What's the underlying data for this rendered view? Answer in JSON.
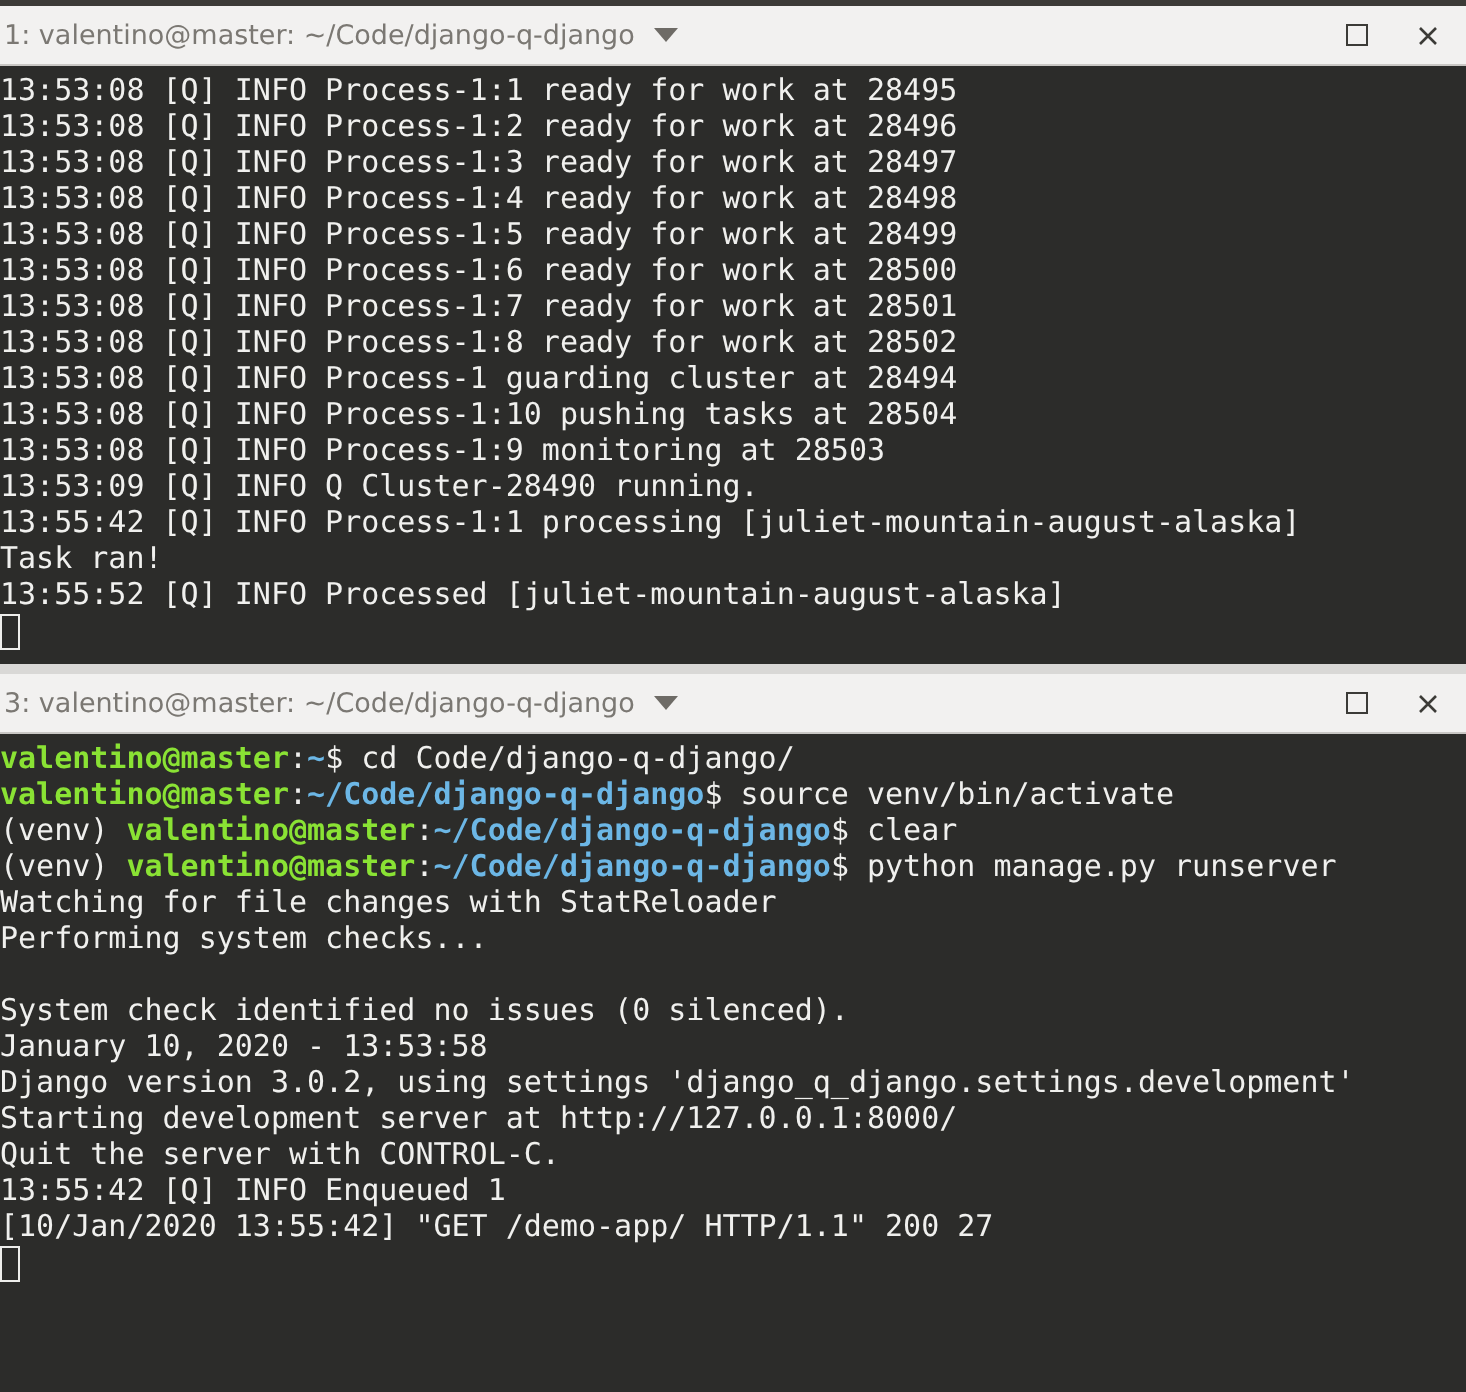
{
  "panes": [
    {
      "title": "1: valentino@master: ~/Code/django-q-django",
      "lines": [
        {
          "segments": [
            {
              "kind": "plain",
              "text": "13:53:08 [Q] INFO Process-1:1 ready for work at 28495"
            }
          ]
        },
        {
          "segments": [
            {
              "kind": "plain",
              "text": "13:53:08 [Q] INFO Process-1:2 ready for work at 28496"
            }
          ]
        },
        {
          "segments": [
            {
              "kind": "plain",
              "text": "13:53:08 [Q] INFO Process-1:3 ready for work at 28497"
            }
          ]
        },
        {
          "segments": [
            {
              "kind": "plain",
              "text": "13:53:08 [Q] INFO Process-1:4 ready for work at 28498"
            }
          ]
        },
        {
          "segments": [
            {
              "kind": "plain",
              "text": "13:53:08 [Q] INFO Process-1:5 ready for work at 28499"
            }
          ]
        },
        {
          "segments": [
            {
              "kind": "plain",
              "text": "13:53:08 [Q] INFO Process-1:6 ready for work at 28500"
            }
          ]
        },
        {
          "segments": [
            {
              "kind": "plain",
              "text": "13:53:08 [Q] INFO Process-1:7 ready for work at 28501"
            }
          ]
        },
        {
          "segments": [
            {
              "kind": "plain",
              "text": "13:53:08 [Q] INFO Process-1:8 ready for work at 28502"
            }
          ]
        },
        {
          "segments": [
            {
              "kind": "plain",
              "text": "13:53:08 [Q] INFO Process-1 guarding cluster at 28494"
            }
          ]
        },
        {
          "segments": [
            {
              "kind": "plain",
              "text": "13:53:08 [Q] INFO Process-1:10 pushing tasks at 28504"
            }
          ]
        },
        {
          "segments": [
            {
              "kind": "plain",
              "text": "13:53:08 [Q] INFO Process-1:9 monitoring at 28503"
            }
          ]
        },
        {
          "segments": [
            {
              "kind": "plain",
              "text": "13:53:09 [Q] INFO Q Cluster-28490 running."
            }
          ]
        },
        {
          "segments": [
            {
              "kind": "plain",
              "text": "13:55:42 [Q] INFO Process-1:1 processing [juliet-mountain-august-alaska]"
            }
          ]
        },
        {
          "segments": [
            {
              "kind": "plain",
              "text": "Task ran!"
            }
          ]
        },
        {
          "segments": [
            {
              "kind": "plain",
              "text": "13:55:52 [Q] INFO Processed [juliet-mountain-august-alaska]"
            }
          ]
        }
      ]
    },
    {
      "title": "3: valentino@master: ~/Code/django-q-django",
      "lines": [
        {
          "segments": [
            {
              "kind": "user",
              "text": "valentino@master"
            },
            {
              "kind": "plain",
              "text": ":"
            },
            {
              "kind": "path",
              "text": "~"
            },
            {
              "kind": "plain",
              "text": "$ cd Code/django-q-django/"
            }
          ]
        },
        {
          "segments": [
            {
              "kind": "user",
              "text": "valentino@master"
            },
            {
              "kind": "plain",
              "text": ":"
            },
            {
              "kind": "path",
              "text": "~/Code/django-q-django"
            },
            {
              "kind": "plain",
              "text": "$ source venv/bin/activate"
            }
          ]
        },
        {
          "segments": [
            {
              "kind": "plain",
              "text": "(venv) "
            },
            {
              "kind": "user",
              "text": "valentino@master"
            },
            {
              "kind": "plain",
              "text": ":"
            },
            {
              "kind": "path",
              "text": "~/Code/django-q-django"
            },
            {
              "kind": "plain",
              "text": "$ clear"
            }
          ]
        },
        {
          "segments": [
            {
              "kind": "plain",
              "text": "(venv) "
            },
            {
              "kind": "user",
              "text": "valentino@master"
            },
            {
              "kind": "plain",
              "text": ":"
            },
            {
              "kind": "path",
              "text": "~/Code/django-q-django"
            },
            {
              "kind": "plain",
              "text": "$ python manage.py runserver"
            }
          ]
        },
        {
          "segments": [
            {
              "kind": "plain",
              "text": "Watching for file changes with StatReloader"
            }
          ]
        },
        {
          "segments": [
            {
              "kind": "plain",
              "text": "Performing system checks..."
            }
          ]
        },
        {
          "blank": true
        },
        {
          "segments": [
            {
              "kind": "plain",
              "text": "System check identified no issues (0 silenced)."
            }
          ]
        },
        {
          "segments": [
            {
              "kind": "plain",
              "text": "January 10, 2020 - 13:53:58"
            }
          ]
        },
        {
          "segments": [
            {
              "kind": "plain",
              "text": "Django version 3.0.2, using settings 'django_q_django.settings.development'"
            }
          ]
        },
        {
          "segments": [
            {
              "kind": "plain",
              "text": "Starting development server at http://127.0.0.1:8000/"
            }
          ]
        },
        {
          "segments": [
            {
              "kind": "plain",
              "text": "Quit the server with CONTROL-C."
            }
          ]
        },
        {
          "segments": [
            {
              "kind": "plain",
              "text": "13:55:42 [Q] INFO Enqueued 1"
            }
          ]
        },
        {
          "segments": [
            {
              "kind": "plain",
              "text": "[10/Jan/2020 13:55:42] \"GET /demo-app/ HTTP/1.1\" 200 27"
            }
          ]
        }
      ]
    }
  ]
}
